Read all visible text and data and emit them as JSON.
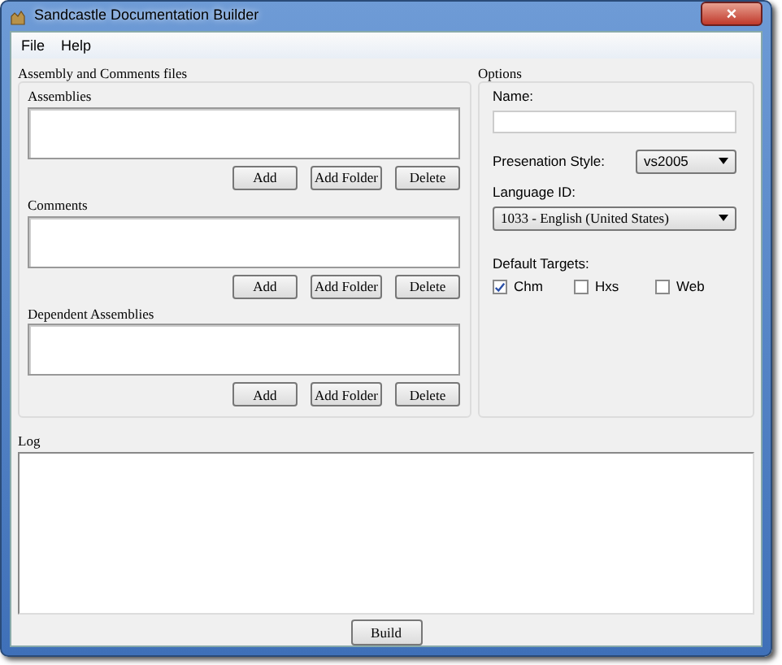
{
  "window": {
    "title": "Sandcastle Documentation Builder",
    "close": "×"
  },
  "menu": [
    "File",
    "Help"
  ],
  "files_group": {
    "title": "Assembly and Comments files",
    "lists": [
      {
        "label": "Assemblies",
        "buttons": [
          "Add",
          "Add Folder",
          "Delete"
        ]
      },
      {
        "label": "Comments",
        "buttons": [
          "Add",
          "Add Folder",
          "Delete"
        ]
      },
      {
        "label": "Dependent Assemblies",
        "buttons": [
          "Add",
          "Add Folder",
          "Delete"
        ]
      }
    ]
  },
  "options": {
    "title": "Options",
    "name_label": "Name:",
    "style_label": "Presenation Style:",
    "style_value": "vs2005",
    "language_label": "Language ID:",
    "language_value": "1033 - English (United States)",
    "targets_label": "Default Targets:",
    "targets": [
      {
        "label": "Chm",
        "checked": true
      },
      {
        "label": "Hxs",
        "checked": false
      },
      {
        "label": "Web",
        "checked": false
      }
    ]
  },
  "log": {
    "label": "Log"
  },
  "build_button": "Build"
}
